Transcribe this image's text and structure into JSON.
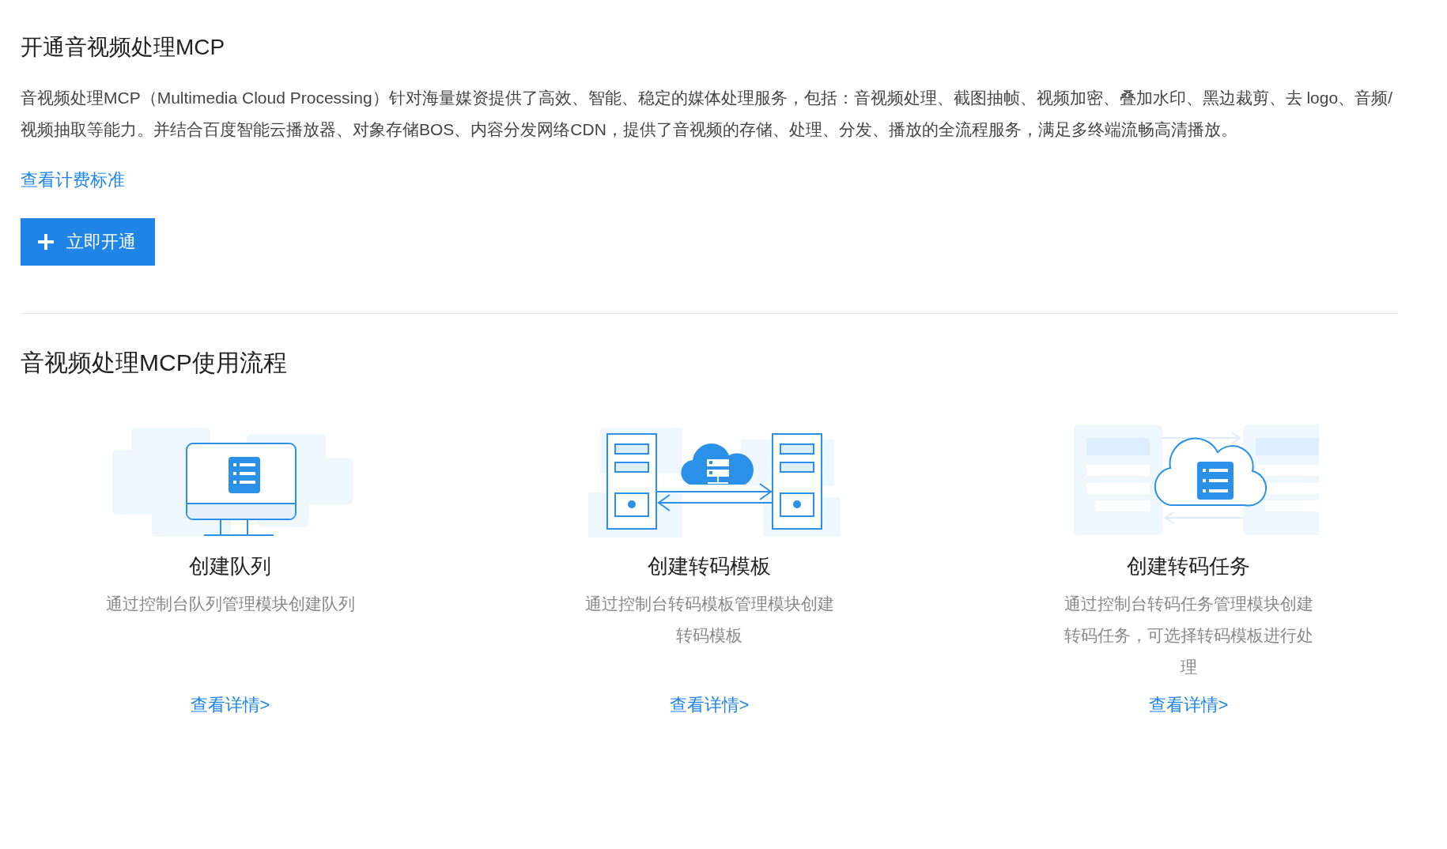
{
  "intro": {
    "title": "开通音视频处理MCP",
    "description": "音视频处理MCP（Multimedia Cloud Processing）针对海量媒资提供了高效、智能、稳定的媒体处理服务，包括：音视频处理、截图抽帧、视频加密、叠加水印、黑边裁剪、去 logo、音频/视频抽取等能力。并结合百度智能云播放器、对象存储BOS、内容分发网络CDN，提供了音视频的存储、处理、分发、播放的全流程服务，满足多终端流畅高清播放。",
    "pricing_link": "查看计费标准",
    "activate_button": "立即开通"
  },
  "workflow": {
    "title": "音视频处理MCP使用流程",
    "steps": [
      {
        "kind": "monitor",
        "title": "创建队列",
        "description": "通过控制台队列管理模块创建队列",
        "link": "查看详情>"
      },
      {
        "kind": "servers",
        "title": "创建转码模板",
        "description": "通过控制台转码模板管理模块创建转码模板",
        "link": "查看详情>"
      },
      {
        "kind": "cloud",
        "title": "创建转码任务",
        "description": "通过控制台转码任务管理模块创建转码任务，可选择转码模板进行处理",
        "link": "查看详情>"
      }
    ]
  }
}
